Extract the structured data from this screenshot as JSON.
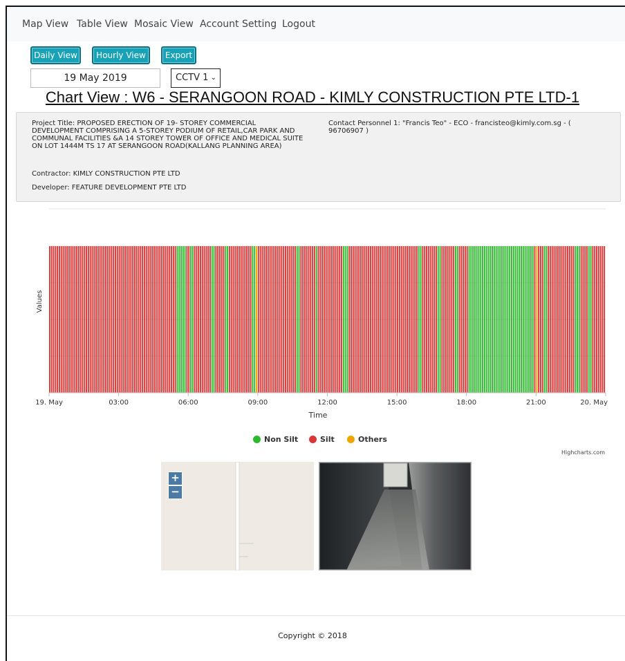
{
  "nav": {
    "items": [
      {
        "label": "Map View"
      },
      {
        "label": "Table View"
      },
      {
        "label": "Mosaic View"
      },
      {
        "label": "Account Setting"
      },
      {
        "label": "Logout"
      }
    ]
  },
  "toolbar": {
    "daily_label": "Daily View",
    "hourly_label": "Hourly View",
    "export_label": "Export"
  },
  "date_field": {
    "value": "19 May 2019"
  },
  "camera_select": {
    "selected": "CCTV 1"
  },
  "title": "Chart View : W6 - SERANGOON ROAD - KIMLY CONSTRUCTION PTE LTD-1",
  "info": {
    "project_title": "Project Title: PROPOSED ERECTION OF 19- STOREY COMMERCIAL DEVELOPMENT COMPRISING A 5-STOREY PODIUM OF RETAIL,CAR PARK AND COMMUNAL FACILITIES &A 14 STOREY TOWER OF OFFICE AND MEDICAL SUITE ON LOT 1444M TS 17 AT SERANGOON ROAD(KALLANG PLANNING AREA)",
    "contractor": "Contractor: KIMLY CONSTRUCTION PTE LTD",
    "developer": "Developer: FEATURE DEVELOPMENT PTE LTD",
    "contact": "Contact Personnel 1: \"Francis Teo\" - ECO - francisteo@kimly.com.sg - ( 96706907 )"
  },
  "chart_data": {
    "type": "bar",
    "xlabel": "Time",
    "ylabel": "Values",
    "x_ticks": [
      "19. May",
      "03:00",
      "06:00",
      "09:00",
      "12:00",
      "15:00",
      "18:00",
      "21:00",
      "20. May"
    ],
    "x_range": [
      "2019-05-19 00:00",
      "2019-05-20 00:00"
    ],
    "series": [
      {
        "name": "Non Silt",
        "color": "#2eb82e"
      },
      {
        "name": "Silt",
        "color": "#d93636"
      },
      {
        "name": "Others",
        "color": "#f0a500"
      }
    ],
    "interval_minutes": 5,
    "segments": [
      [
        "00:00",
        "05:30",
        "Silt"
      ],
      [
        "05:30",
        "05:55",
        "Non Silt"
      ],
      [
        "06:05",
        "06:15",
        "Non Silt"
      ],
      [
        "07:00",
        "07:10",
        "Non Silt"
      ],
      [
        "07:35",
        "07:45",
        "Non Silt"
      ],
      [
        "08:45",
        "08:55",
        "Non Silt"
      ],
      [
        "08:55",
        "09:00",
        "Others"
      ],
      [
        "10:40",
        "10:50",
        "Non Silt"
      ],
      [
        "11:30",
        "11:35",
        "Non Silt"
      ],
      [
        "12:40",
        "12:55",
        "Non Silt"
      ],
      [
        "15:55",
        "16:05",
        "Non Silt"
      ],
      [
        "16:45",
        "16:55",
        "Non Silt"
      ],
      [
        "17:30",
        "17:40",
        "Non Silt"
      ],
      [
        "18:05",
        "20:55",
        "Non Silt"
      ],
      [
        "21:00",
        "21:05",
        "Others"
      ],
      [
        "21:20",
        "21:30",
        "Non Silt"
      ],
      [
        "22:40",
        "22:55",
        "Non Silt"
      ],
      [
        "23:15",
        "23:25",
        "Non Silt"
      ]
    ]
  },
  "credits": "Highcharts.com",
  "map": {
    "zoom_in": "+",
    "zoom_out": "−"
  },
  "footer": "Copyright © 2018"
}
